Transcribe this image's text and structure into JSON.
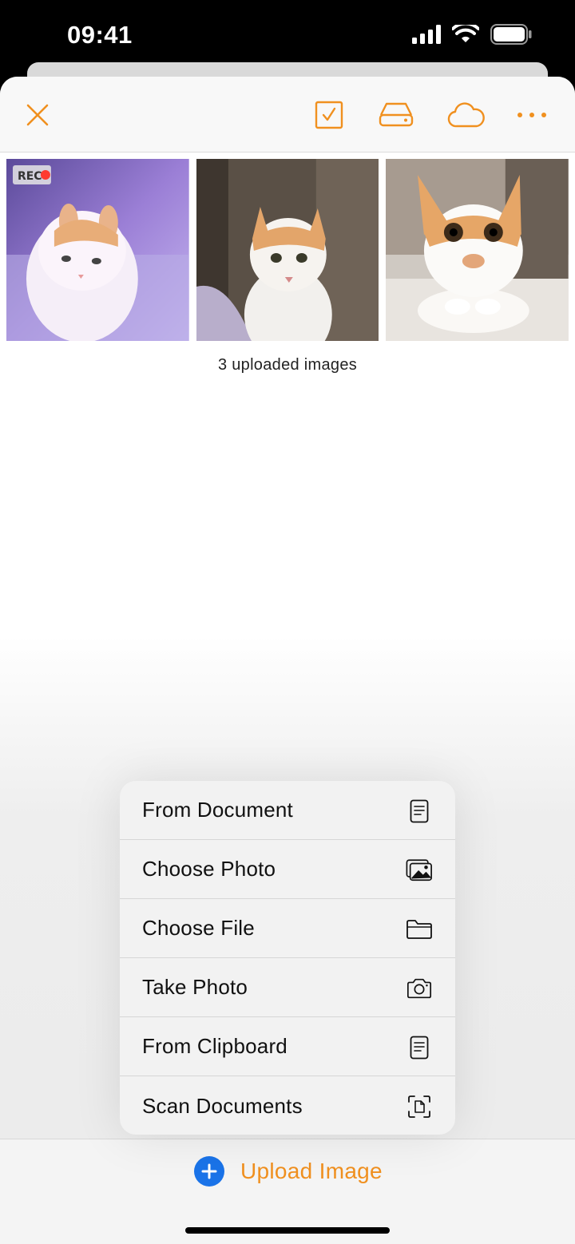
{
  "status_bar": {
    "time": "09:41"
  },
  "toolbar": {
    "accent_color": "#f0901f",
    "buttons": [
      {
        "name": "close",
        "icon": "close-icon"
      },
      {
        "name": "select",
        "icon": "checkbox-icon"
      },
      {
        "name": "storage",
        "icon": "drive-icon"
      },
      {
        "name": "cloud",
        "icon": "cloud-icon"
      },
      {
        "name": "more",
        "icon": "more-icon"
      }
    ]
  },
  "gallery": {
    "caption": "3 uploaded images",
    "images": [
      {
        "subject": "cat",
        "badge": "REC"
      },
      {
        "subject": "cat"
      },
      {
        "subject": "cat"
      }
    ]
  },
  "menu": {
    "items": [
      {
        "label": "From Document",
        "icon": "document-icon"
      },
      {
        "label": "Choose Photo",
        "icon": "photo-library-icon"
      },
      {
        "label": "Choose File",
        "icon": "folder-icon"
      },
      {
        "label": "Take Photo",
        "icon": "camera-icon"
      },
      {
        "label": "From Clipboard",
        "icon": "clipboard-icon"
      },
      {
        "label": "Scan Documents",
        "icon": "scan-document-icon"
      }
    ]
  },
  "bottom_bar": {
    "upload_label": "Upload Image",
    "plus_color": "#1a73e8"
  }
}
